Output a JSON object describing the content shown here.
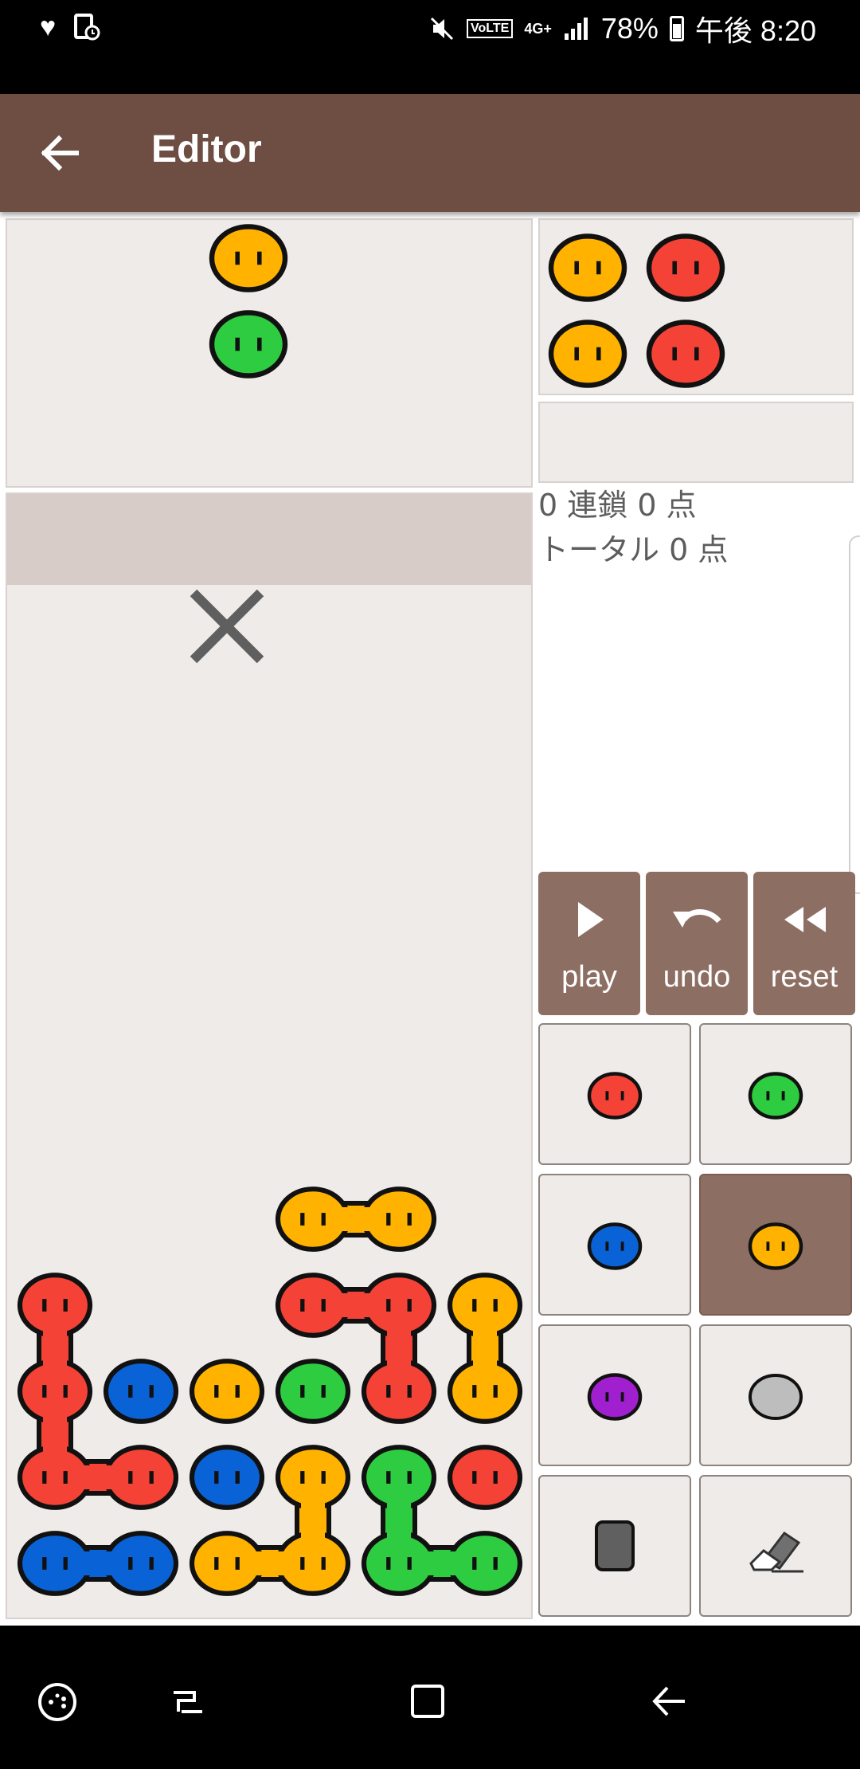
{
  "status_bar": {
    "battery_percent": "78%",
    "clock": "午後 8:20",
    "volte_label": "VoLTE",
    "network_label": "4G+",
    "icons": [
      "heart-icon",
      "screen-record-icon",
      "mute-icon",
      "volte-icon",
      "signal-icon",
      "battery-icon"
    ]
  },
  "app_bar": {
    "title": "Editor",
    "back_icon": "arrow-left-icon"
  },
  "colors": {
    "red": "#f44336",
    "green": "#2ecc40",
    "blue": "#0a63d6",
    "yellow": "#ffb300",
    "purple": "#a020d0",
    "gray": "#bdbdbd",
    "block": "#606060",
    "outline": "#111111",
    "app_bar": "#6e4e42",
    "button": "#8d6e63",
    "panel": "#efebe9"
  },
  "next_piece": [
    {
      "color": "yellow",
      "col": 2,
      "row": 0
    },
    {
      "color": "green",
      "col": 2,
      "row": 1
    }
  ],
  "next_queue": [
    {
      "color": "yellow",
      "col": 0,
      "row": 0
    },
    {
      "color": "red",
      "col": 1,
      "row": 0
    },
    {
      "color": "yellow",
      "col": 0,
      "row": 1
    },
    {
      "color": "red",
      "col": 1,
      "row": 1
    }
  ],
  "field": {
    "columns": 6,
    "rows": 12,
    "death_marker": {
      "col": 2,
      "row": 0,
      "icon": "x-mark-icon"
    },
    "cells": [
      {
        "col": 3,
        "row": 7,
        "color": "yellow"
      },
      {
        "col": 4,
        "row": 7,
        "color": "yellow"
      },
      {
        "col": 0,
        "row": 8,
        "color": "red"
      },
      {
        "col": 3,
        "row": 8,
        "color": "red"
      },
      {
        "col": 4,
        "row": 8,
        "color": "red"
      },
      {
        "col": 5,
        "row": 8,
        "color": "yellow"
      },
      {
        "col": 0,
        "row": 9,
        "color": "red"
      },
      {
        "col": 1,
        "row": 9,
        "color": "blue"
      },
      {
        "col": 2,
        "row": 9,
        "color": "yellow"
      },
      {
        "col": 3,
        "row": 9,
        "color": "green"
      },
      {
        "col": 4,
        "row": 9,
        "color": "red"
      },
      {
        "col": 5,
        "row": 9,
        "color": "yellow"
      },
      {
        "col": 0,
        "row": 10,
        "color": "red"
      },
      {
        "col": 1,
        "row": 10,
        "color": "red"
      },
      {
        "col": 2,
        "row": 10,
        "color": "blue"
      },
      {
        "col": 3,
        "row": 10,
        "color": "yellow"
      },
      {
        "col": 4,
        "row": 10,
        "color": "green"
      },
      {
        "col": 5,
        "row": 10,
        "color": "red"
      },
      {
        "col": 0,
        "row": 11,
        "color": "blue"
      },
      {
        "col": 1,
        "row": 11,
        "color": "blue"
      },
      {
        "col": 2,
        "row": 11,
        "color": "yellow"
      },
      {
        "col": 3,
        "row": 11,
        "color": "yellow"
      },
      {
        "col": 4,
        "row": 11,
        "color": "green"
      },
      {
        "col": 5,
        "row": 11,
        "color": "green"
      }
    ]
  },
  "score": {
    "chain_line": "0 連鎖 0 点",
    "total_line": "トータル 0 点"
  },
  "controls": {
    "play": {
      "label": "play",
      "icon": "play-icon"
    },
    "undo": {
      "label": "undo",
      "icon": "undo-icon"
    },
    "reset": {
      "label": "reset",
      "icon": "rewind-icon"
    }
  },
  "palette": {
    "selected": "yellow",
    "items": [
      {
        "id": "red",
        "icon": "red-puyo-icon"
      },
      {
        "id": "green",
        "icon": "green-puyo-icon"
      },
      {
        "id": "blue",
        "icon": "blue-puyo-icon"
      },
      {
        "id": "yellow",
        "icon": "yellow-puyo-icon"
      },
      {
        "id": "purple",
        "icon": "purple-puyo-icon"
      },
      {
        "id": "gray",
        "icon": "garbage-puyo-icon"
      },
      {
        "id": "block",
        "icon": "block-icon"
      },
      {
        "id": "eraser",
        "icon": "eraser-icon"
      }
    ]
  },
  "nav_bar": {
    "icons": [
      "game-tools-icon",
      "recent-apps-icon",
      "home-icon",
      "back-icon"
    ]
  }
}
